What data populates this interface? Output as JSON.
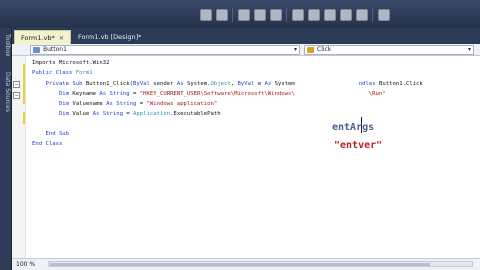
{
  "tabs": [
    {
      "label": "Form1.vb*",
      "active": true
    },
    {
      "label": "Form1.vb [Design]*",
      "active": false
    }
  ],
  "side_panel": {
    "toolbox": "Toolbox",
    "data_sources": "Data Sources"
  },
  "navbar": {
    "object_combo": "Button1",
    "event_combo": "Click"
  },
  "code_lines": [
    {
      "segments": [
        {
          "t": "Imports Microsoft.Win32",
          "c": ""
        }
      ]
    },
    {
      "segments": [
        {
          "t": "Public Class ",
          "c": "kw"
        },
        {
          "t": "Form1",
          "c": "ty"
        }
      ]
    },
    {
      "segments": [
        {
          "t": "    Private Sub ",
          "c": "kw"
        },
        {
          "t": "Button1_Click(",
          "c": ""
        },
        {
          "t": "ByVal",
          "c": "kw"
        },
        {
          "t": " sender ",
          "c": ""
        },
        {
          "t": "As",
          "c": "kw"
        },
        {
          "t": " System.",
          "c": ""
        },
        {
          "t": "Object",
          "c": "ty"
        },
        {
          "t": ", ",
          "c": ""
        },
        {
          "t": "ByVal",
          "c": "kw"
        },
        {
          "t": " e ",
          "c": ""
        },
        {
          "t": "As",
          "c": "kw"
        },
        {
          "t": " System",
          "c": ""
        },
        {
          "t": "                   ",
          "c": ""
        },
        {
          "t": "ndles ",
          "c": "kw"
        },
        {
          "t": "Button1.Click",
          "c": ""
        }
      ]
    },
    {
      "segments": [
        {
          "t": "        Dim",
          "c": "kw"
        },
        {
          "t": " Keyname ",
          "c": ""
        },
        {
          "t": "As String",
          "c": "kw"
        },
        {
          "t": " = ",
          "c": ""
        },
        {
          "t": "\"HKEY_CURRENT_USER\\Software\\Microsoft\\Windows\\",
          "c": "str"
        },
        {
          "t": "                      ",
          "c": ""
        },
        {
          "t": "\\Run\"",
          "c": "str"
        }
      ]
    },
    {
      "segments": [
        {
          "t": "        Dim",
          "c": "kw"
        },
        {
          "t": " Valuename ",
          "c": ""
        },
        {
          "t": "As String",
          "c": "kw"
        },
        {
          "t": " = ",
          "c": ""
        },
        {
          "t": "\"Windows application\"",
          "c": "str"
        }
      ]
    },
    {
      "segments": [
        {
          "t": "        Dim",
          "c": "kw"
        },
        {
          "t": " Value ",
          "c": ""
        },
        {
          "t": "As String",
          "c": "kw"
        },
        {
          "t": " = ",
          "c": ""
        },
        {
          "t": "Application",
          "c": "ty"
        },
        {
          "t": ".ExecutablePath",
          "c": ""
        }
      ]
    },
    {
      "segments": [
        {
          "t": "",
          "c": ""
        }
      ]
    },
    {
      "segments": [
        {
          "t": "    End Sub",
          "c": "kw"
        }
      ]
    },
    {
      "segments": [
        {
          "t": "End Class",
          "c": "kw"
        }
      ]
    }
  ],
  "overlay_text_1": "entArgs",
  "overlay_text_2": "\"entver\"",
  "status": {
    "zoom": "100 %"
  }
}
